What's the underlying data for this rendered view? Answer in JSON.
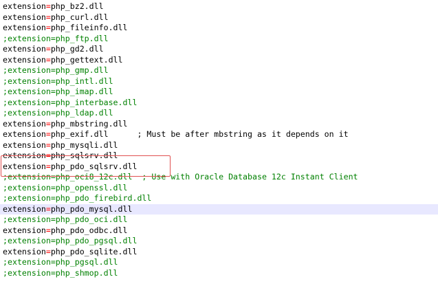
{
  "editor": {
    "lines": [
      {
        "text": "extension=php_bz2.dll",
        "commented": false
      },
      {
        "text": "extension=php_curl.dll",
        "commented": false
      },
      {
        "text": "extension=php_fileinfo.dll",
        "commented": false
      },
      {
        "text": ";extension=php_ftp.dll",
        "commented": true
      },
      {
        "text": "extension=php_gd2.dll",
        "commented": false
      },
      {
        "text": "extension=php_gettext.dll",
        "commented": false
      },
      {
        "text": ";extension=php_gmp.dll",
        "commented": true
      },
      {
        "text": ";extension=php_intl.dll",
        "commented": true
      },
      {
        "text": ";extension=php_imap.dll",
        "commented": true
      },
      {
        "text": ";extension=php_interbase.dll",
        "commented": true
      },
      {
        "text": ";extension=php_ldap.dll",
        "commented": true
      },
      {
        "text": "extension=php_mbstring.dll",
        "commented": false
      },
      {
        "text": "extension=php_exif.dll      ; Must be after mbstring as it depends on it",
        "commented": false
      },
      {
        "text": "extension=php_mysqli.dll",
        "commented": false
      },
      {
        "text": "extension=php_sqlsrv.dll",
        "commented": false
      },
      {
        "text": "extension=php_pdo_sqlsrv.dll",
        "commented": false
      },
      {
        "text": ";extension=php_oci8_12c.dll  ; Use with Oracle Database 12c Instant Client",
        "commented": true
      },
      {
        "text": ";extension=php_openssl.dll",
        "commented": true
      },
      {
        "text": ";extension=php_pdo_firebird.dll",
        "commented": true
      },
      {
        "text": "extension=php_pdo_mysql.dll",
        "commented": false,
        "current": true
      },
      {
        "text": ";extension=php_pdo_oci.dll",
        "commented": true
      },
      {
        "text": "extension=php_pdo_odbc.dll",
        "commented": false
      },
      {
        "text": ";extension=php_pdo_pgsql.dll",
        "commented": true
      },
      {
        "text": "extension=php_pdo_sqlite.dll",
        "commented": false
      },
      {
        "text": ";extension=php_pgsql.dll",
        "commented": true
      },
      {
        "text": ";extension=php_shmop.dll",
        "commented": true
      }
    ]
  },
  "colors": {
    "text": "#000000",
    "comment": "#008000",
    "operator": "#ff0000",
    "current_line": "#e8e8ff",
    "highlight_box": "#e05050"
  }
}
